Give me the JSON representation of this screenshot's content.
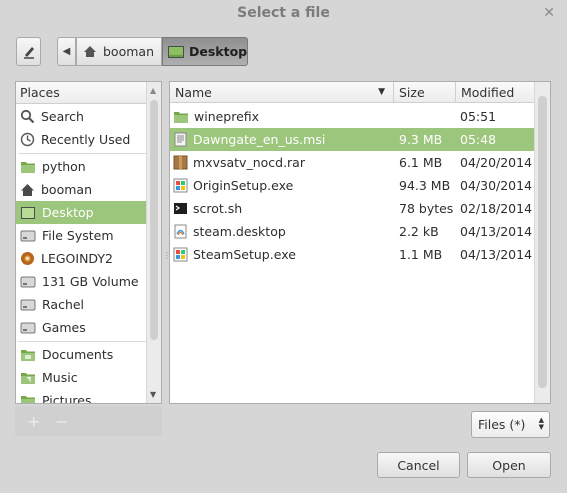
{
  "window": {
    "title": "Select a file",
    "close": "✕"
  },
  "pathbar": {
    "back": "◀",
    "crumbs": [
      {
        "label": "booman"
      },
      {
        "label": "Desktop"
      }
    ]
  },
  "places": {
    "header": "Places",
    "items": [
      {
        "label": "Search",
        "icon": "search-icon"
      },
      {
        "label": "Recently Used",
        "icon": "clock-icon"
      },
      {
        "label": "python",
        "icon": "folder-icon"
      },
      {
        "label": "booman",
        "icon": "home-icon"
      },
      {
        "label": "Desktop",
        "icon": "desktop-icon",
        "selected": true
      },
      {
        "label": "File System",
        "icon": "drive-icon"
      },
      {
        "label": "LEGOINDY2",
        "icon": "disc-icon"
      },
      {
        "label": "131 GB Volume",
        "icon": "drive-icon"
      },
      {
        "label": "Rachel",
        "icon": "drive-icon"
      },
      {
        "label": "Games",
        "icon": "drive-icon"
      },
      {
        "label": "Documents",
        "icon": "folder-icon"
      },
      {
        "label": "Music",
        "icon": "music-folder-icon"
      },
      {
        "label": "Pictures",
        "icon": "pictures-folder-icon"
      }
    ],
    "add": "+",
    "remove": "−"
  },
  "files": {
    "columns": {
      "name": "Name",
      "size": "Size",
      "modified": "Modified"
    },
    "rows": [
      {
        "name": "wineprefix",
        "size": "",
        "modified": "05:51",
        "icon": "folder-icon"
      },
      {
        "name": "Dawngate_en_us.msi",
        "size": "9.3 MB",
        "modified": "05:48",
        "icon": "document-icon",
        "selected": true
      },
      {
        "name": "mxvsatv_nocd.rar",
        "size": "6.1 MB",
        "modified": "04/20/2014",
        "icon": "archive-icon"
      },
      {
        "name": "OriginSetup.exe",
        "size": "94.3 MB",
        "modified": "04/30/2014",
        "icon": "exe-icon"
      },
      {
        "name": "scrot.sh",
        "size": "78 bytes",
        "modified": "02/18/2014",
        "icon": "terminal-icon"
      },
      {
        "name": "steam.desktop",
        "size": "2.2 kB",
        "modified": "04/13/2014",
        "icon": "desktop-file-icon"
      },
      {
        "name": "SteamSetup.exe",
        "size": "1.1 MB",
        "modified": "04/13/2014",
        "icon": "exe-icon"
      }
    ]
  },
  "filter": {
    "value": "Files (*)"
  },
  "buttons": {
    "cancel": "Cancel",
    "open": "Open"
  },
  "colors": {
    "selection": "#9cc67b",
    "background": "#d6d6d6"
  }
}
